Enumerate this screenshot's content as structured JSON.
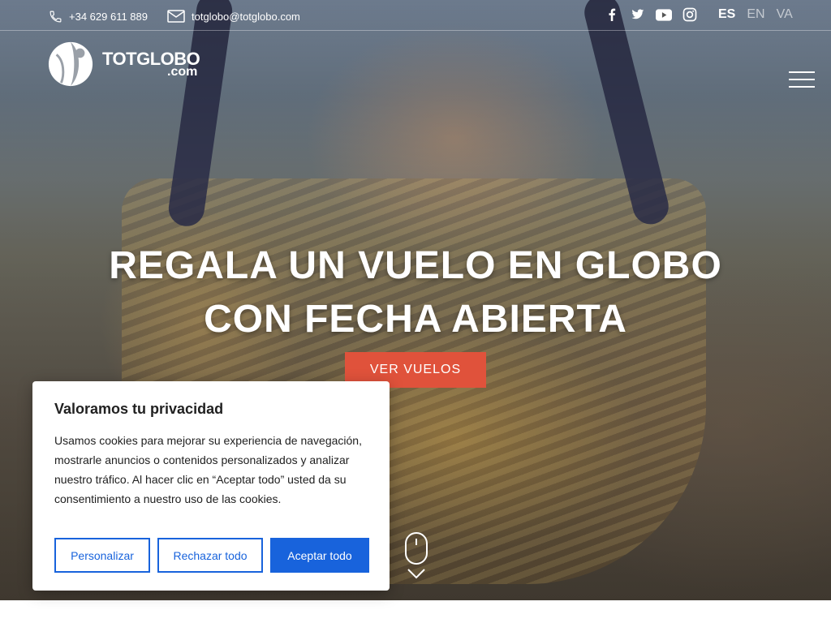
{
  "topbar": {
    "phone": "+34 629 611 889",
    "email": "totglobo@totglobo.com",
    "socials": [
      "facebook-icon",
      "twitter-icon",
      "youtube-icon",
      "instagram-icon"
    ],
    "languages": [
      {
        "code": "ES",
        "active": true
      },
      {
        "code": "EN",
        "active": false
      },
      {
        "code": "VA",
        "active": false
      }
    ]
  },
  "logo": {
    "main": "TOTGLOBO",
    "sub": ".com"
  },
  "hero": {
    "line1": "REGALA UN VUELO EN GLOBO",
    "line2": "CON FECHA ABIERTA",
    "cta": "VER VUELOS"
  },
  "cookie": {
    "title": "Valoramos tu privacidad",
    "text": "Usamos cookies para mejorar su experiencia de navegación, mostrarle anuncios o contenidos personalizados y analizar nuestro tráfico. Al hacer clic en “Aceptar todo” usted da su consentimiento a nuestro uso de las cookies.",
    "customize": "Personalizar",
    "reject": "Rechazar todo",
    "accept": "Aceptar todo"
  },
  "colors": {
    "cta": "#e0523b",
    "consent_blue": "#1863dc"
  }
}
